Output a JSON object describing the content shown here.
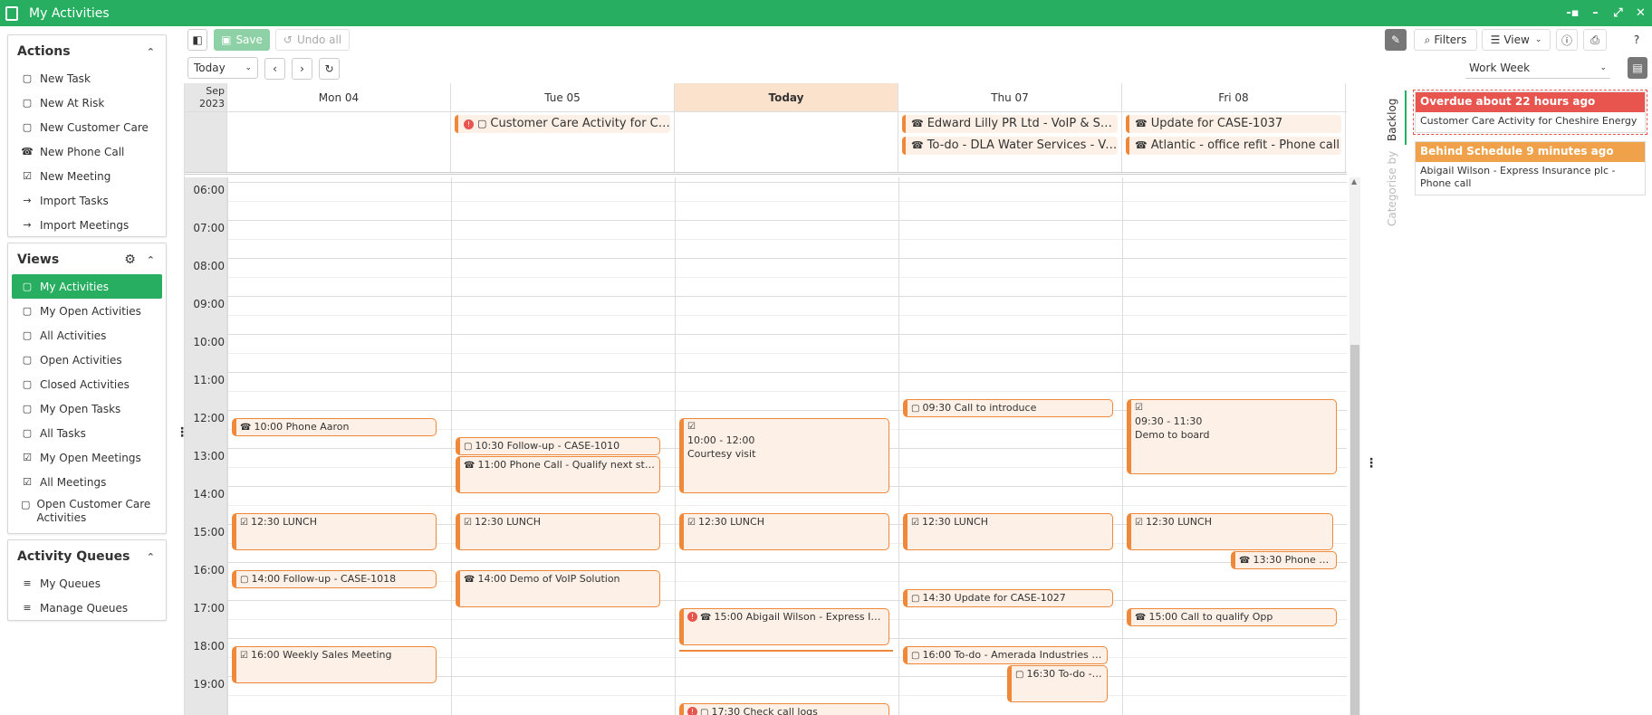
{
  "window": {
    "title": "My Activities"
  },
  "actions": {
    "title": "Actions",
    "items": [
      {
        "label": "New Task",
        "icon": "task-icon"
      },
      {
        "label": "New At Risk",
        "icon": "task-icon"
      },
      {
        "label": "New Customer Care",
        "icon": "task-icon"
      },
      {
        "label": "New Phone Call",
        "icon": "phone-icon"
      },
      {
        "label": "New Meeting",
        "icon": "calendar-check-icon"
      },
      {
        "label": "Import Tasks",
        "icon": "import-icon"
      },
      {
        "label": "Import Meetings",
        "icon": "import-icon"
      }
    ]
  },
  "views": {
    "title": "Views",
    "items": [
      {
        "label": "My Activities"
      },
      {
        "label": "My Open Activities"
      },
      {
        "label": "All Activities"
      },
      {
        "label": "Open Activities"
      },
      {
        "label": "Closed Activities"
      },
      {
        "label": "My Open Tasks"
      },
      {
        "label": "All Tasks"
      },
      {
        "label": "My Open Meetings"
      },
      {
        "label": "All Meetings"
      },
      {
        "label": "Open Customer Care Activities"
      }
    ]
  },
  "queues": {
    "title": "Activity Queues",
    "items": [
      {
        "label": "My Queues"
      },
      {
        "label": "Manage Queues"
      }
    ]
  },
  "toolbar": {
    "save": "Save",
    "undo": "Undo all",
    "today": "Today",
    "filters": "Filters",
    "view": "View",
    "range": "Work Week"
  },
  "calendar": {
    "corner_month": "Sep",
    "corner_year": "2023",
    "days": [
      "Mon 04",
      "Tue 05",
      "Today",
      "Thu 07",
      "Fri 08"
    ],
    "hours": [
      "06:00",
      "07:00",
      "08:00",
      "09:00",
      "10:00",
      "11:00",
      "12:00",
      "13:00",
      "14:00",
      "15:00",
      "16:00",
      "17:00",
      "18:00",
      "19:00"
    ],
    "allday": [
      {
        "day": 1,
        "text": "Customer Care Activity for Che...",
        "row": 0
      },
      {
        "day": 3,
        "text": "Edward Lilly PR Ltd - VoIP & Supp...",
        "row": 0
      },
      {
        "day": 3,
        "text": "To-do - DLA Water Services - VoIP ...",
        "row": 1
      },
      {
        "day": 4,
        "text": "Update for CASE-1037",
        "row": 0
      },
      {
        "day": 4,
        "text": "Atlantic - office refit - Phone call",
        "row": 1
      }
    ],
    "events": [
      {
        "text": "10:00 Phone Aaron"
      },
      {
        "text": "12:30 LUNCH"
      },
      {
        "text": "14:00 Follow-up - CASE-1018"
      },
      {
        "text": "16:00 Weekly Sales Meeting"
      },
      {
        "text": "10:30 Follow-up - CASE-1010"
      },
      {
        "text": "11:00 Phone Call - Qualify next steps"
      },
      {
        "text": "12:30 LUNCH"
      },
      {
        "text": "14:00 Demo of VoIP Solution"
      },
      {
        "time": "10:00 - 12:00",
        "title": "Courtesy visit"
      },
      {
        "text": "12:30 LUNCH"
      },
      {
        "text": "15:00 Abigail Wilson - Express Ins..."
      },
      {
        "text": "17:30 Check call logs"
      },
      {
        "text": "09:30 Call to introduce"
      },
      {
        "text": "12:30 LUNCH"
      },
      {
        "text": "14:30 Update for CASE-1027"
      },
      {
        "text": "16:00 To-do - Amerada Industries - ..."
      },
      {
        "text": "16:30 To-do - ..."
      },
      {
        "time": "09:30 - 11:30",
        "title": "Demo to board"
      },
      {
        "text": "12:30 LUNCH"
      },
      {
        "text": "13:30 Phone C..."
      },
      {
        "text": "15:00 Call to qualify Opp"
      }
    ]
  },
  "side_tabs": {
    "backlog": "Backlog",
    "categorise": "Categorise by"
  },
  "backlog": [
    {
      "header": "Overdue about 22 hours ago",
      "body": "Customer Care Activity for Cheshire Energy",
      "color": "#e8554e"
    },
    {
      "header": "Behind Schedule 9 minutes ago",
      "body": "Abigail Wilson - Express Insurance plc - Phone call",
      "color": "#f0a24a"
    }
  ]
}
